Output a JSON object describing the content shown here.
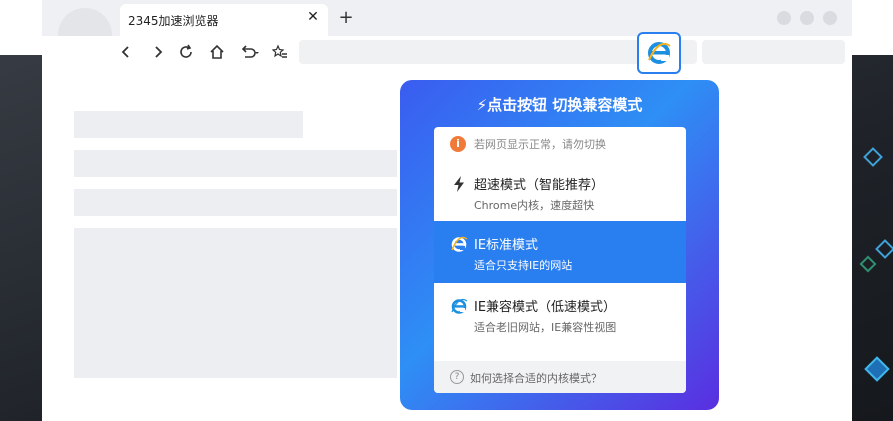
{
  "tab": {
    "title": "2345加速浏览器",
    "close": "✕"
  },
  "new_tab": "+",
  "toolbar": {
    "back": "back-arrow-icon",
    "forward": "forward-arrow-icon",
    "reload": "reload-icon",
    "home": "home-icon",
    "undo": "undo-icon",
    "favorites": "star-list-icon"
  },
  "popup": {
    "title": "⚡点击按钮 切换兼容模式",
    "notice": "若网页显示正常，请勿切换",
    "notice_icon": "i",
    "options": [
      {
        "name": "超速模式（智能推荐）",
        "desc": "Chrome内核，速度超快",
        "icon": "lightning-icon",
        "selected": false
      },
      {
        "name": "IE标准模式",
        "desc": "适合只支持IE的网站",
        "icon": "ie-icon",
        "selected": true
      },
      {
        "name": "IE兼容模式（低速模式）",
        "desc": "适合老旧网站，IE兼容性视图",
        "icon": "ie-icon",
        "selected": false
      }
    ],
    "help_icon": "?",
    "help": "如何选择合适的内核模式？"
  },
  "colors": {
    "accent": "#2a7ff0",
    "notice": "#f07a3a"
  }
}
